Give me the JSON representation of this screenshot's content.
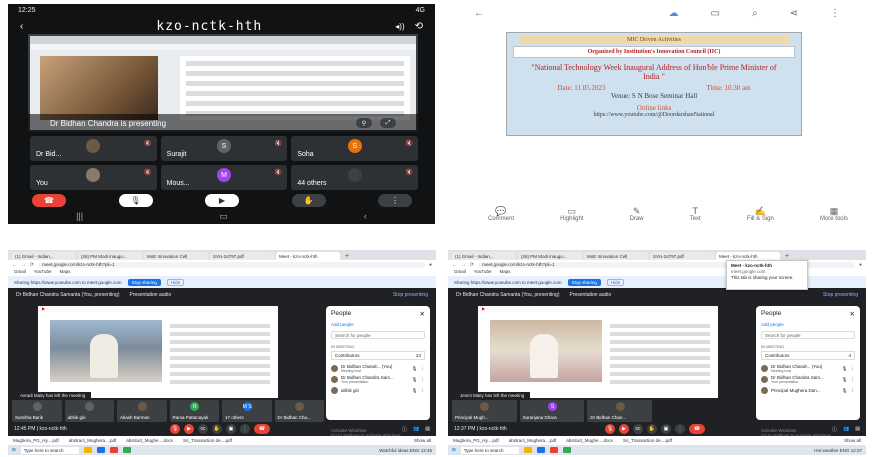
{
  "phone_meet": {
    "status_time": "12:25",
    "status_right": "4G",
    "meeting_code": "kzo-nctk-hth",
    "volume_badge": "◂))",
    "presenting_text": "Dr Bidhan Chandra is presenting",
    "tiles": [
      {
        "name": "Dr Bid...",
        "initial": "",
        "color": "#6b5a45"
      },
      {
        "name": "Surajit",
        "initial": "S",
        "color": "#5f6368"
      },
      {
        "name": "Soha",
        "initial": "S",
        "color": "#e8710a"
      },
      {
        "name": "You",
        "initial": "",
        "color": "#8a7a6a"
      },
      {
        "name": "Mous...",
        "initial": "M",
        "color": "#a142f4"
      },
      {
        "name": "44 others",
        "initial": "",
        "color": "#3c4043"
      }
    ]
  },
  "doc_viewer": {
    "banner": "MIC Driven Activities",
    "organizer": "Organized by Institution's Innovation Council (IIC)",
    "headline": "\"National Technology Week Inaugural Address of Hon'ble Prime Minister of India \"",
    "date": "Date: 11.05.2023",
    "time": "Time: 10.30 am",
    "venue": "Venue: S N Bose Seminar Hall",
    "links_title": "Online links",
    "url": "https://www.youtube.com/@DoordarshanNational",
    "tools": [
      {
        "icon": "💬",
        "label": "Comment"
      },
      {
        "icon": "▭",
        "label": "Highlight"
      },
      {
        "icon": "✎",
        "label": "Draw"
      },
      {
        "icon": "T",
        "label": "Text"
      },
      {
        "icon": "✍",
        "label": "Fill & Sign"
      },
      {
        "icon": "▦",
        "label": "More tools"
      }
    ]
  },
  "desk_meet_a": {
    "tabs": [
      "(1) Gmail - Indian...",
      "(28) PM Modi inaugu...",
      "MoE Innovation Cell",
      "SVU-24797.pdf",
      "Meet - kzo-nctk-hth"
    ],
    "url": "meet.google.com/kzo-nctk-hth?pli=1",
    "bookmarks": [
      "Gmail",
      "YouTube",
      "Maps"
    ],
    "share_text": "Sharing https://www.youtube.com to meet.google.com",
    "stop_sharing": "Stop sharing",
    "hide": "Hide",
    "presenter": "Dr Bidhan Chandra Samanta (You, presenting)",
    "presentation_audio": "Presentation audio",
    "stop_presenting": "Stop presenting",
    "toast": "Avradi Maity has left the meeting",
    "strip": [
      {
        "name": "Sumitha Barik",
        "initial": "",
        "color": "#5f6368"
      },
      {
        "name": "abhik giri",
        "initial": "",
        "color": "#5f6368"
      },
      {
        "name": "Akash Barman",
        "initial": "",
        "color": "#6b5a45"
      },
      {
        "name": "Rama Pattanayak",
        "initial": "R",
        "color": "#34a853"
      },
      {
        "name": "17 others",
        "initial": "M S",
        "color": "#1a73e8"
      },
      {
        "name": "Dr Bidhan Cha...",
        "initial": "",
        "color": "#6b5a45"
      }
    ],
    "time_code": "12:45 PM | kzo-nctk-hth",
    "people": {
      "title": "People",
      "add": "Add people",
      "search": "Search for people",
      "section": "IN MEETING",
      "contributors": "Contributors",
      "count": "24",
      "rows": [
        {
          "name": "Dr Bidhan Chandr... (You)",
          "sub": "Meeting host"
        },
        {
          "name": "Dr Bidhan Chandra Sam...",
          "sub": "Your presentation"
        },
        {
          "name": "abhik giri",
          "sub": ""
        }
      ]
    },
    "activate": [
      "Activate Windows",
      "Go to Settings to activate Windows."
    ],
    "downloads": [
      "Mughera_PG_Hy....pdf",
      "abstract_Mughera....pdf",
      "abstract_Mughe....docx",
      "Sri_Transaction de....pdf"
    ],
    "show_all": "Show all",
    "taskbar_search": "Type here to search",
    "taskbar_tray": "Watchful ideas ENG 12:45"
  },
  "desk_meet_b": {
    "tabs": [
      "(1) Gmail - Indian...",
      "(28) PM Modi inaugu...",
      "MoE Innovation Cell",
      "SVU-24797.pdf",
      "Meet - kzo-nctk-hth"
    ],
    "url": "meet.google.com/kzo-nctk-hth?pli=1",
    "tooltip_title": "Meet - kzo-nctk-hth",
    "tooltip_url": "meet.google.com",
    "tooltip_note": "This tab is sharing your screen.",
    "share_text": "Sharing https://www.youtube.com to meet.google.com",
    "stop_sharing": "Stop sharing",
    "hide": "Hide",
    "presenter": "Dr Bidhan Chandra Samanta (You, presenting)",
    "presentation_audio": "Presentation audio",
    "stop_presenting": "Stop presenting",
    "toast": "Jesmi Maity has left the meeting",
    "strip": [
      {
        "name": "Principal Mugh...",
        "initial": "",
        "color": "#6b5a45"
      },
      {
        "name": "Suranjana Dhara",
        "initial": "S",
        "color": "#a142f4"
      },
      {
        "name": "Dr Bidhan Chan...",
        "initial": "",
        "color": "#6b5a45"
      }
    ],
    "time_code": "12:37 PM | kzo-nctk-hth",
    "people": {
      "title": "People",
      "add": "Add people",
      "search": "Search for people",
      "section": "IN MEETING",
      "contributors": "Contributors",
      "count": "4",
      "rows": [
        {
          "name": "Dr Bidhan Chandr... (You)",
          "sub": "Meeting host"
        },
        {
          "name": "Dr Bidhan Chandra Sam...",
          "sub": "Your presentation"
        },
        {
          "name": "Principal Mughera Dan...",
          "sub": ""
        }
      ]
    },
    "activate": [
      "Activate Windows",
      "Go to Settings to activate Windows."
    ],
    "downloads": [
      "Mughera_PG_Hy....pdf",
      "abstract_Mughera....pdf",
      "abstract_Mughe....docx",
      "Sri_Transaction de....pdf"
    ],
    "show_all": "Show all",
    "taskbar_search": "Type here to search",
    "taskbar_tray": "Hot weather ENG 12:37"
  }
}
